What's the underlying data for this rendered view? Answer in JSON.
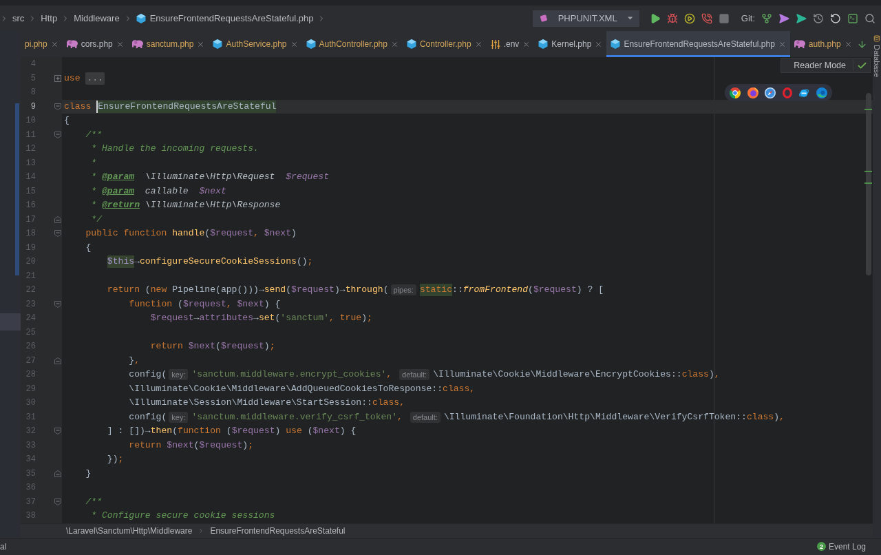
{
  "navigation_bar": {
    "breadcrumbs": [
      {
        "label": "src",
        "kind": "folder"
      },
      {
        "label": "Http",
        "kind": "folder"
      },
      {
        "label": "Middleware",
        "kind": "folder"
      },
      {
        "label": "EnsureFrontendRequestsAreStateful.php",
        "kind": "file"
      }
    ],
    "run_configuration": "PHPUNIT.XML",
    "vcs_label": "Git:"
  },
  "tabs": [
    {
      "label": "pi.php",
      "kind": "clipped",
      "color": "#d5a55c",
      "selected": false
    },
    {
      "label": "cors.php",
      "kind": "config",
      "color": "#b8bcc4",
      "selected": false
    },
    {
      "label": "sanctum.php",
      "kind": "config",
      "color": "#d5a55c",
      "selected": false
    },
    {
      "label": "AuthService.php",
      "kind": "class",
      "color": "#d5a55c",
      "selected": false
    },
    {
      "label": "AuthController.php",
      "kind": "class",
      "color": "#d5a55c",
      "selected": false
    },
    {
      "label": "Controller.php",
      "kind": "class",
      "color": "#d5a55c",
      "selected": false
    },
    {
      "label": ".env",
      "kind": "env",
      "color": "#b8bcc4",
      "selected": false
    },
    {
      "label": "Kernel.php",
      "kind": "class",
      "color": "#b8bcc4",
      "selected": false
    },
    {
      "label": "EnsureFrontendRequestsAreStateful.php",
      "kind": "class",
      "color": "#b8bcc4",
      "selected": true
    },
    {
      "label": "auth.php",
      "kind": "config",
      "color": "#d5a55c",
      "selected": false
    }
  ],
  "reader_mode": {
    "label": "Reader Mode"
  },
  "editor": {
    "lines": [
      {
        "number": "4",
        "current": false
      },
      {
        "number": "5",
        "current": false,
        "fold_marker": {
          "kind": "collapsed"
        },
        "tokens": [
          {
            "text": "use ",
            "kind": "keyword"
          },
          {
            "text": "...",
            "kind": "folded"
          }
        ]
      },
      {
        "number": "8",
        "current": false
      },
      {
        "number": "9",
        "current": true,
        "fold_marker": {
          "kind": "start"
        },
        "tokens": [
          {
            "text": "class ",
            "kind": "keyword"
          },
          {
            "text": "EnsureFrontendRequestsAreStateful",
            "kind": "declaration",
            "caret": true
          }
        ]
      },
      {
        "number": "10",
        "current": false,
        "tokens": [
          {
            "text": "{",
            "kind": "plain"
          }
        ]
      },
      {
        "number": "11",
        "current": false,
        "fold_marker": {
          "kind": "start"
        },
        "tokens": [
          {
            "text": "    /**",
            "kind": "comment"
          }
        ]
      },
      {
        "number": "12",
        "current": false,
        "tokens": [
          {
            "text": "     * Handle the incoming requests.",
            "kind": "comment"
          }
        ]
      },
      {
        "number": "13",
        "current": false,
        "tokens": [
          {
            "text": "     *",
            "kind": "comment"
          }
        ]
      },
      {
        "number": "14",
        "current": false,
        "tokens": [
          {
            "text": "     * ",
            "kind": "comment"
          },
          {
            "text": "@param",
            "kind": "doc_tag"
          },
          {
            "text": "  \\Illuminate\\Http\\Request  ",
            "kind": "doc_type"
          },
          {
            "text": "$request",
            "kind": "doc_variable"
          }
        ]
      },
      {
        "number": "15",
        "current": false,
        "tokens": [
          {
            "text": "     * ",
            "kind": "comment"
          },
          {
            "text": "@param",
            "kind": "doc_tag"
          },
          {
            "text": "  callable  ",
            "kind": "doc_type"
          },
          {
            "text": "$next",
            "kind": "doc_variable"
          }
        ]
      },
      {
        "number": "16",
        "current": false,
        "tokens": [
          {
            "text": "     * ",
            "kind": "comment"
          },
          {
            "text": "@return",
            "kind": "doc_tag"
          },
          {
            "text": " \\Illuminate\\Http\\Response",
            "kind": "doc_type"
          }
        ]
      },
      {
        "number": "17",
        "current": false,
        "fold_marker": {
          "kind": "end"
        },
        "tokens": [
          {
            "text": "     */",
            "kind": "comment"
          }
        ]
      },
      {
        "number": "18",
        "current": false,
        "fold_marker": {
          "kind": "start"
        },
        "tokens": [
          {
            "text": "    public function ",
            "kind": "keyword"
          },
          {
            "text": "handle",
            "kind": "function"
          },
          {
            "text": "(",
            "kind": "plain"
          },
          {
            "text": "$request",
            "kind": "variable"
          },
          {
            "text": ", ",
            "kind": "punctuation"
          },
          {
            "text": "$next",
            "kind": "variable"
          },
          {
            "text": ")",
            "kind": "plain"
          }
        ]
      },
      {
        "number": "19",
        "current": false,
        "tokens": [
          {
            "text": "    {",
            "kind": "plain"
          }
        ]
      },
      {
        "number": "20",
        "current": false,
        "tokens": [
          {
            "text": "        $this",
            "kind": "this"
          },
          {
            "text": "→",
            "kind": "plain"
          },
          {
            "text": "configureSecureCookieSessions",
            "kind": "function"
          },
          {
            "text": "()",
            "kind": "plain"
          },
          {
            "text": ";",
            "kind": "punctuation"
          }
        ]
      },
      {
        "number": "21",
        "current": false
      },
      {
        "number": "22",
        "current": false,
        "tokens": [
          {
            "text": "        return",
            "kind": "keyword"
          },
          {
            "text": " (",
            "kind": "plain"
          },
          {
            "text": "new",
            "kind": "keyword"
          },
          {
            "text": " Pipeline(app()))→",
            "kind": "plain"
          },
          {
            "text": "send",
            "kind": "function"
          },
          {
            "text": "(",
            "kind": "plain"
          },
          {
            "text": "$request",
            "kind": "variable"
          },
          {
            "text": ")→",
            "kind": "plain"
          },
          {
            "text": "through",
            "kind": "function"
          },
          {
            "text": "(",
            "kind": "plain"
          },
          {
            "text": "pipes:",
            "kind": "hint"
          },
          {
            "text": "static",
            "kind": "static"
          },
          {
            "text": "::",
            "kind": "plain"
          },
          {
            "text": "fromFrontend",
            "kind": "static_call"
          },
          {
            "text": "(",
            "kind": "plain"
          },
          {
            "text": "$request",
            "kind": "variable"
          },
          {
            "text": ") ? [",
            "kind": "plain"
          }
        ]
      },
      {
        "number": "23",
        "current": false,
        "fold_marker": {
          "kind": "start"
        },
        "tokens": [
          {
            "text": "            function",
            "kind": "keyword"
          },
          {
            "text": " (",
            "kind": "plain"
          },
          {
            "text": "$request",
            "kind": "variable"
          },
          {
            "text": ", ",
            "kind": "punctuation"
          },
          {
            "text": "$next",
            "kind": "variable"
          },
          {
            "text": ") {",
            "kind": "plain"
          }
        ]
      },
      {
        "number": "24",
        "current": false,
        "tokens": [
          {
            "text": "                $request",
            "kind": "variable"
          },
          {
            "text": "→",
            "kind": "plain"
          },
          {
            "text": "attributes",
            "kind": "variable"
          },
          {
            "text": "→",
            "kind": "plain"
          },
          {
            "text": "set",
            "kind": "function"
          },
          {
            "text": "(",
            "kind": "plain"
          },
          {
            "text": "'sanctum'",
            "kind": "string"
          },
          {
            "text": ", ",
            "kind": "punctuation"
          },
          {
            "text": "true",
            "kind": "keyword"
          },
          {
            "text": ")",
            "kind": "plain"
          },
          {
            "text": ";",
            "kind": "punctuation"
          }
        ]
      },
      {
        "number": "25",
        "current": false
      },
      {
        "number": "26",
        "current": false,
        "tokens": [
          {
            "text": "                return ",
            "kind": "keyword"
          },
          {
            "text": "$next",
            "kind": "variable"
          },
          {
            "text": "(",
            "kind": "plain"
          },
          {
            "text": "$request",
            "kind": "variable"
          },
          {
            "text": ")",
            "kind": "plain"
          },
          {
            "text": ";",
            "kind": "punctuation"
          }
        ]
      },
      {
        "number": "27",
        "current": false,
        "fold_marker": {
          "kind": "end"
        },
        "tokens": [
          {
            "text": "            }",
            "kind": "plain"
          },
          {
            "text": ",",
            "kind": "punctuation"
          }
        ]
      },
      {
        "number": "28",
        "current": false,
        "tokens": [
          {
            "text": "            config(",
            "kind": "plain"
          },
          {
            "text": "key:",
            "kind": "hint"
          },
          {
            "text": "'sanctum.middleware.encrypt_cookies'",
            "kind": "string"
          },
          {
            "text": ", ",
            "kind": "punctuation"
          },
          {
            "text": "default:",
            "kind": "hint"
          },
          {
            "text": "\\Illuminate\\Cookie\\Middleware\\EncryptCookies::",
            "kind": "plain"
          },
          {
            "text": "class",
            "kind": "keyword"
          },
          {
            "text": ")",
            "kind": "plain"
          },
          {
            "text": ",",
            "kind": "punctuation"
          }
        ]
      },
      {
        "number": "29",
        "current": false,
        "tokens": [
          {
            "text": "            \\Illuminate\\Cookie\\Middleware\\AddQueuedCookiesToResponse::",
            "kind": "plain"
          },
          {
            "text": "class",
            "kind": "keyword"
          },
          {
            "text": ",",
            "kind": "punctuation"
          }
        ]
      },
      {
        "number": "30",
        "current": false,
        "tokens": [
          {
            "text": "            \\Illuminate\\Session\\Middleware\\StartSession::",
            "kind": "plain"
          },
          {
            "text": "class",
            "kind": "keyword"
          },
          {
            "text": ",",
            "kind": "punctuation"
          }
        ]
      },
      {
        "number": "31",
        "current": false,
        "tokens": [
          {
            "text": "            config(",
            "kind": "plain"
          },
          {
            "text": "key:",
            "kind": "hint"
          },
          {
            "text": "'sanctum.middleware.verify_csrf_token'",
            "kind": "string"
          },
          {
            "text": ", ",
            "kind": "punctuation"
          },
          {
            "text": "default:",
            "kind": "hint"
          },
          {
            "text": "\\Illuminate\\Foundation\\Http\\Middleware\\VerifyCsrfToken::",
            "kind": "plain"
          },
          {
            "text": "class",
            "kind": "keyword"
          },
          {
            "text": ")",
            "kind": "plain"
          },
          {
            "text": ",",
            "kind": "punctuation"
          }
        ]
      },
      {
        "number": "32",
        "current": false,
        "fold_marker": {
          "kind": "start"
        },
        "tokens": [
          {
            "text": "        ] : [])→",
            "kind": "plain"
          },
          {
            "text": "then",
            "kind": "function"
          },
          {
            "text": "(",
            "kind": "plain"
          },
          {
            "text": "function",
            "kind": "keyword"
          },
          {
            "text": " (",
            "kind": "plain"
          },
          {
            "text": "$request",
            "kind": "variable"
          },
          {
            "text": ") ",
            "kind": "plain"
          },
          {
            "text": "use",
            "kind": "keyword"
          },
          {
            "text": " (",
            "kind": "plain"
          },
          {
            "text": "$next",
            "kind": "variable"
          },
          {
            "text": ") {",
            "kind": "plain"
          }
        ]
      },
      {
        "number": "33",
        "current": false,
        "tokens": [
          {
            "text": "            return ",
            "kind": "keyword"
          },
          {
            "text": "$next",
            "kind": "variable"
          },
          {
            "text": "(",
            "kind": "plain"
          },
          {
            "text": "$request",
            "kind": "variable"
          },
          {
            "text": ")",
            "kind": "plain"
          },
          {
            "text": ";",
            "kind": "punctuation"
          }
        ]
      },
      {
        "number": "34",
        "current": false,
        "tokens": [
          {
            "text": "        })",
            "kind": "plain"
          },
          {
            "text": ";",
            "kind": "punctuation"
          }
        ]
      },
      {
        "number": "35",
        "current": false,
        "fold_marker": {
          "kind": "end"
        },
        "tokens": [
          {
            "text": "    }",
            "kind": "plain"
          }
        ]
      },
      {
        "number": "36",
        "current": false
      },
      {
        "number": "37",
        "current": false,
        "fold_marker": {
          "kind": "start"
        },
        "tokens": [
          {
            "text": "    /**",
            "kind": "comment"
          }
        ]
      },
      {
        "number": "38",
        "current": false,
        "tokens": [
          {
            "text": "     * Configure secure cookie sessions",
            "kind": "comment"
          }
        ]
      }
    ]
  },
  "breadcrumb_bar": {
    "items": [
      "\\Laravel\\Sanctum\\Http\\Middleware",
      "EnsureFrontendRequestsAreStateful"
    ]
  },
  "right_strip": {
    "label": "Database"
  },
  "status_bar": {
    "tool_label": "al",
    "event_log": {
      "count": "2",
      "label": "Event Log"
    }
  }
}
